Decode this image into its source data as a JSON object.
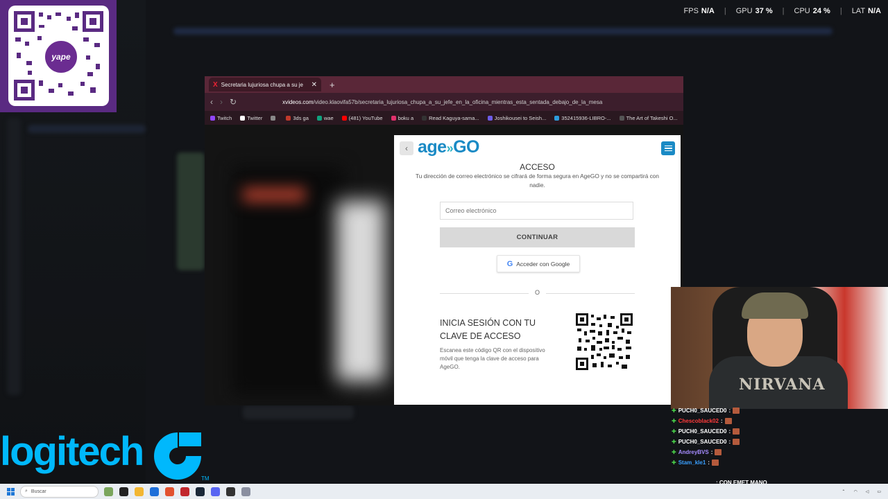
{
  "overlay_stats": {
    "fps_label": "FPS",
    "fps_value": "N/A",
    "gpu_label": "GPU",
    "gpu_value": "37 %",
    "cpu_label": "CPU",
    "cpu_value": "24 %",
    "lat_label": "LAT",
    "lat_value": "N/A"
  },
  "qr_panel": {
    "badge_text": "yape"
  },
  "browser": {
    "tab_title": "Secretaria lujuriosa chupa a su je",
    "url_domain": "xvideos.com",
    "url_path": "/video.klaovifa57b/secretaria_lujuriosa_chupa_a_su_jefe_en_la_oficina_mientras_esta_sentada_debajo_de_la_mesa",
    "bookmarks": [
      {
        "label": "Twitch",
        "color": "#9146ff"
      },
      {
        "label": "Twitter",
        "color": "#ffffff"
      },
      {
        "label": "",
        "color": "#888888"
      },
      {
        "label": "3ds ga",
        "color": "#c0392b"
      },
      {
        "label": "wae",
        "color": "#10a37f"
      },
      {
        "label": "(481) YouTube",
        "color": "#ff0000"
      },
      {
        "label": "boku a",
        "color": "#e1306c"
      },
      {
        "label": "Read Kaguya-sama...",
        "color": "#333333"
      },
      {
        "label": "Joshikousei to Seish...",
        "color": "#6c5ce7"
      },
      {
        "label": "352415936-LIBRO-...",
        "color": "#2d9cdb"
      },
      {
        "label": "The Art of Takeshi O...",
        "color": "#555555"
      }
    ]
  },
  "agego": {
    "logo_left": "age",
    "logo_right": "GO",
    "title": "ACCESO",
    "subtitle": "Tu dirección de correo electrónico se cifrará de forma segura en AgeGO y no se compartirá con nadie.",
    "email_placeholder": "Correo electrónico",
    "continue_label": "CONTINUAR",
    "google_label": "Acceder con Google",
    "or_label": "O",
    "qr_title": "INICIA SESIÓN CON TU CLAVE DE ACCESO",
    "qr_desc": "Escanea este código QR con el dispositivo móvil que tenga la clave de acceso para AgeGO.",
    "brand_color": "#1a8ac5"
  },
  "webcam": {
    "shirt_text": "NIRVANA"
  },
  "chat": [
    {
      "user": "PUCH0_SAUCED0",
      "color": "#ffffff",
      "sep": ":"
    },
    {
      "user": "Chescoblack02",
      "color": "#ff3b3b",
      "sep": ":"
    },
    {
      "user": "PUCH0_SAUCED0",
      "color": "#ffffff",
      "sep": ":"
    },
    {
      "user": "PUCH0_SAUCED0",
      "color": "#ffffff",
      "sep": ":"
    },
    {
      "user": "AndreyBVS",
      "color": "#a68cff",
      "sep": ":"
    },
    {
      "user": "Stam_kle1",
      "color": "#3aa0ff",
      "sep": ":"
    }
  ],
  "chat_last_message": ": CON EMET MANO",
  "logitech": {
    "text": "logitech",
    "tm": "TM"
  },
  "taskbar": {
    "search_placeholder": "Buscar"
  }
}
